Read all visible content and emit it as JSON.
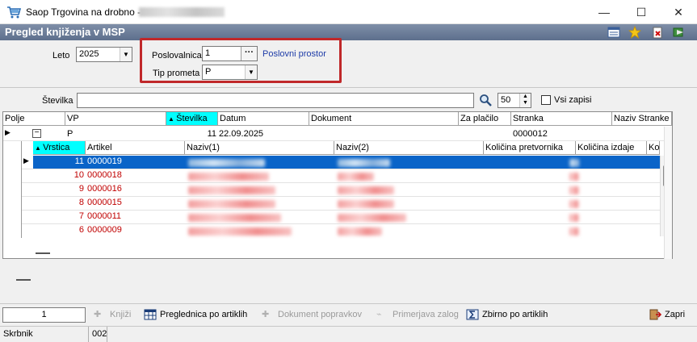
{
  "window": {
    "title": "Saop Trgovina na drobno -",
    "minimize_glyph": "—",
    "maximize_glyph": "☐",
    "close_glyph": "✕"
  },
  "header": {
    "page_title": "Pregled knjiženja v MSP",
    "icons": [
      "list-icon",
      "star-icon",
      "delete-icon",
      "exit-icon"
    ]
  },
  "filters": {
    "leto_label": "Leto",
    "leto_value": "2025",
    "poslovalnica_label": "Poslovalnica",
    "poslovalnica_value": "1",
    "poslovalnica_button": "···",
    "poslovni_prostor_link": "Poslovni prostor",
    "tip_prometa_label": "Tip prometa",
    "tip_prometa_value": "P",
    "stevilka_label": "Številka",
    "stevilka_value": "",
    "count_value": "50",
    "vsi_zapisi_label": "Vsi zapisi"
  },
  "grid": {
    "columns": [
      "Polje",
      "VP",
      "Številka",
      "Datum",
      "Dokument",
      "Za plačilo",
      "Stranka",
      "Naziv Stranke"
    ],
    "sorted_column": "Številka",
    "parent_row": {
      "expander": "−",
      "vp": "P",
      "stevilka": "11",
      "datum": "22.09.2025",
      "dokument": "",
      "za_placilo": "",
      "stranka": "0000012",
      "naziv_stranke": ""
    },
    "detail_columns": [
      "Vrstica",
      "Artikel",
      "Naziv(1)",
      "Naziv(2)",
      "Količina pretvornika",
      "Količina izdaje",
      "Ko"
    ],
    "detail_sorted_column": "Vrstica",
    "detail_rows": [
      {
        "vrstica": "11",
        "artikel": "0000019",
        "selected": true
      },
      {
        "vrstica": "10",
        "artikel": "0000018",
        "selected": false
      },
      {
        "vrstica": "9",
        "artikel": "0000016",
        "selected": false
      },
      {
        "vrstica": "8",
        "artikel": "0000015",
        "selected": false
      },
      {
        "vrstica": "7",
        "artikel": "0000011",
        "selected": false
      },
      {
        "vrstica": "6",
        "artikel": "0000009",
        "selected": false
      }
    ]
  },
  "toolbar": {
    "record_count": "1",
    "knjizi": "Knjiži",
    "preglednica_po_artiklih": "Preglednica po artiklih",
    "dokument_popravkov": "Dokument popravkov",
    "primerjava_zalog": "Primerjava zalog",
    "zbirno_po_artiklih": "Zbirno po artiklih",
    "zapri": "Zapri"
  },
  "status": {
    "user_label": "Skrbnik",
    "code": "002"
  },
  "colors": {
    "header_band": "#6d7f9b",
    "highlight": "#c0282a",
    "sorted_header": "#00ffff",
    "selected_row": "#0a64c8",
    "row_text_red": "#c00000",
    "link": "#1e3ca8"
  }
}
